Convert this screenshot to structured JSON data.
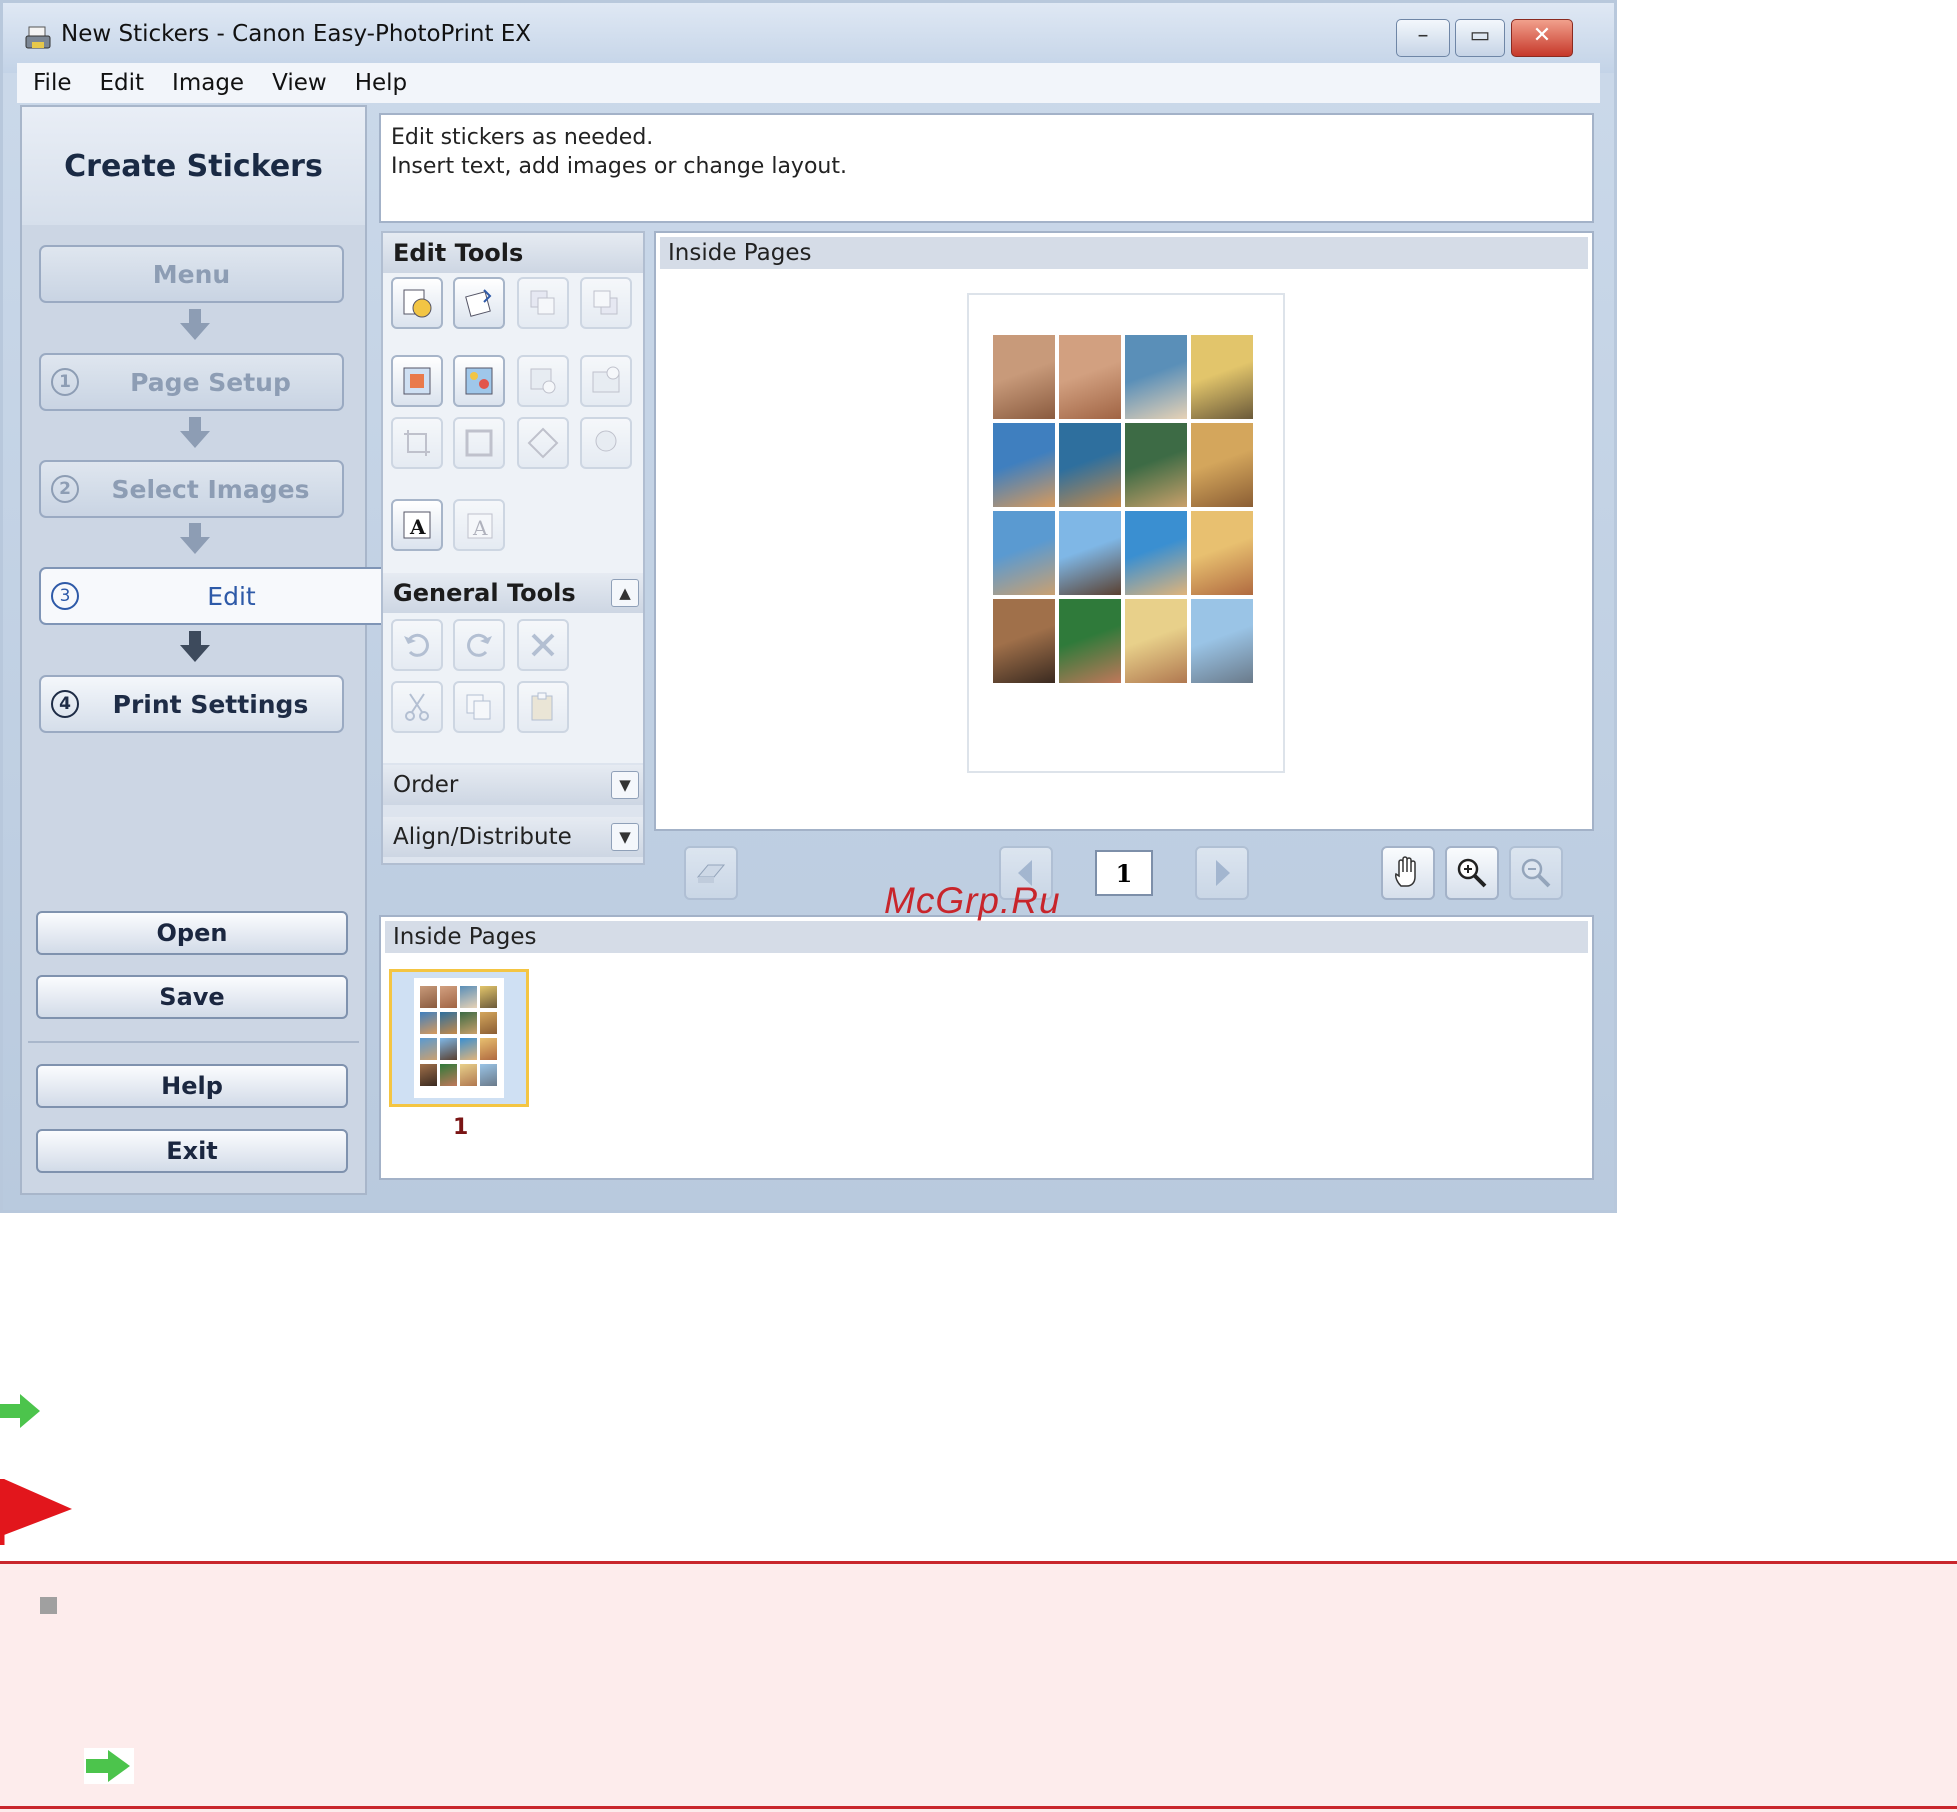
{
  "window": {
    "title": "New Stickers - Canon Easy-PhotoPrint EX",
    "controls": {
      "minimize": "–",
      "maximize": "▭",
      "close": "✕"
    }
  },
  "menubar": [
    "File",
    "Edit",
    "Image",
    "View",
    "Help"
  ],
  "sidebar": {
    "title": "Create Stickers",
    "steps": [
      {
        "num": "",
        "label": "Menu",
        "state": "disabled"
      },
      {
        "num": "1",
        "label": "Page Setup",
        "state": "disabled"
      },
      {
        "num": "2",
        "label": "Select Images",
        "state": "disabled"
      },
      {
        "num": "3",
        "label": "Edit",
        "state": "active"
      },
      {
        "num": "4",
        "label": "Print Settings",
        "state": "enabled"
      }
    ],
    "buttons": {
      "open": "Open",
      "save": "Save",
      "help": "Help",
      "exit": "Exit"
    }
  },
  "instructions": {
    "line1": "Edit stickers as needed.",
    "line2": "Insert text, add images or change layout."
  },
  "tools": {
    "edit_tools": "Edit Tools",
    "general_tools": "General Tools",
    "order": "Order",
    "align_distribute": "Align/Distribute"
  },
  "preview": {
    "header": "Inside Pages",
    "page_number": "1"
  },
  "thumbnails": {
    "header": "Inside Pages",
    "items": [
      {
        "label": "1"
      }
    ]
  },
  "watermark": "McGrp.Ru",
  "colors": {
    "accent": "#2e5aa8",
    "note_border": "#c9262c",
    "note_bg": "#fdecec",
    "arrow_green": "#4cc44c"
  }
}
